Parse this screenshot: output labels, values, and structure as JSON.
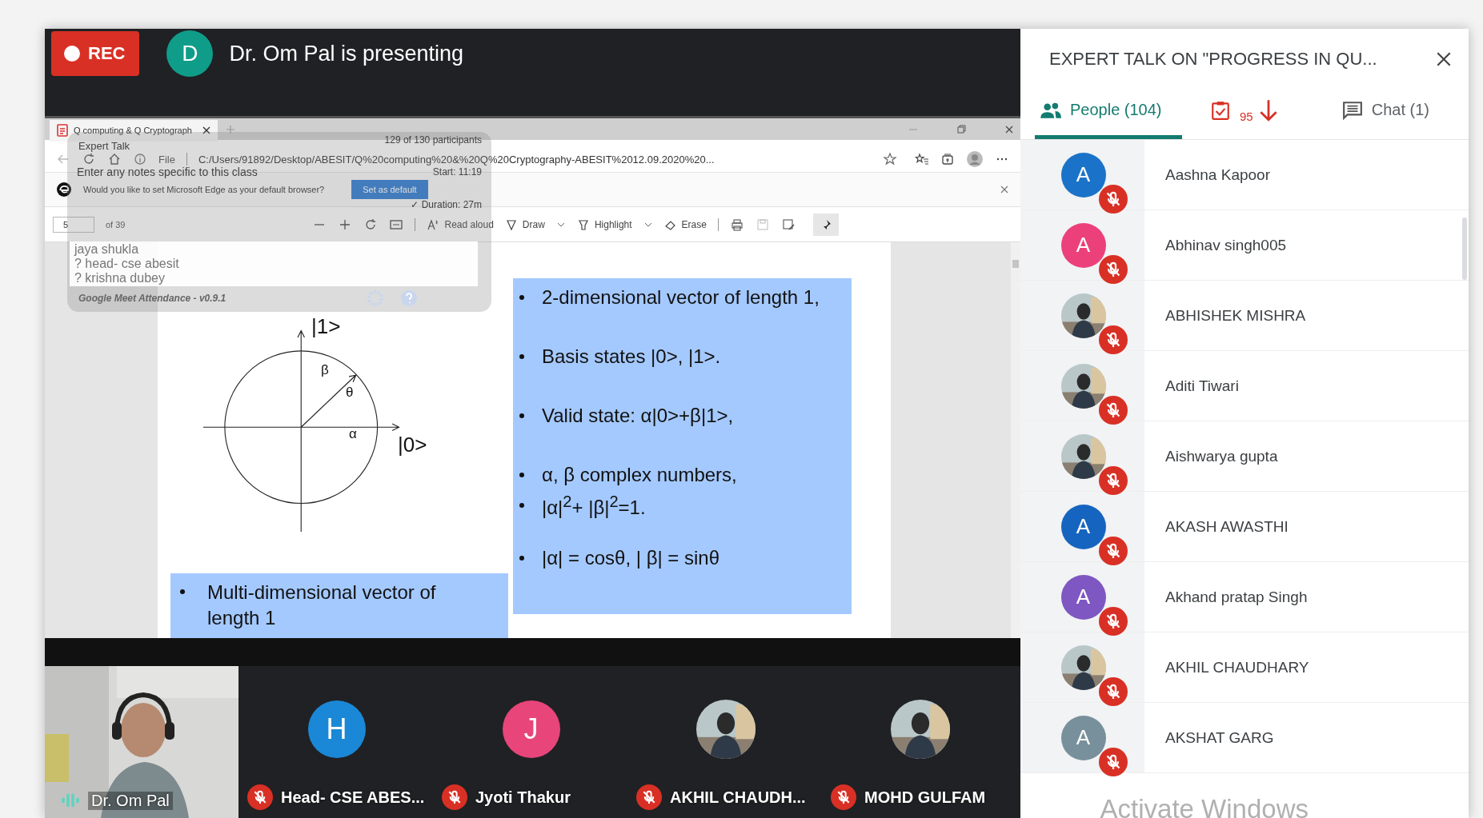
{
  "meeting": {
    "recording_label": "REC",
    "presenter_initial": "D",
    "presenting_text": "Dr. Om Pal is presenting"
  },
  "browser": {
    "tab_title": "Q computing & Q Cryptograph",
    "address_scheme": "File",
    "address": "C:/Users/91892/Desktop/ABESIT/Q%20computing%20&%20Q%20Cryptography-ABESIT%2012.09.2020%20...",
    "infobar": {
      "message": "Would you like to set Microsoft Edge as your default browser?",
      "button": "Set as default"
    },
    "pdf_toolbar": {
      "page": "5",
      "page_count": "of 39",
      "tools": [
        {
          "label": "Read aloud",
          "kind": "read"
        },
        {
          "label": "Draw",
          "kind": "draw"
        },
        {
          "label": "Highlight",
          "kind": "highlight"
        },
        {
          "label": "Erase",
          "kind": "erase"
        }
      ]
    }
  },
  "slide": {
    "axis_y_label": "|1>",
    "axis_x_label": "|0>",
    "beta": "β",
    "theta": "θ",
    "alpha": "α",
    "bullets": [
      {
        "text": "2-dimensional vector of length 1,"
      },
      {
        "text": "Basis states |0>, |1>."
      },
      {
        "text": "Valid state: α|0>+β|1>,"
      },
      {
        "text": " α, β complex numbers,"
      },
      {
        "text": "|α|$^{2}$+ |β|$^{2}$=1."
      },
      {
        "text": "|α| = cosθ, | β| = sinθ"
      }
    ],
    "lower_bullet": "Multi-dimensional vector of length 1"
  },
  "attendance_overlay": {
    "title": "Expert Talk",
    "notes_placeholder": "Enter any notes specific to this class",
    "participants": "129 of 130 participants",
    "start": "Start: 11:19",
    "duration": "✓ Duration: 27m",
    "names": [
      "jaya shukla",
      "? head- cse abesit",
      "? krishna dubey"
    ],
    "footer": "Google Meet Attendance - v0.9.1"
  },
  "tiles": [
    {
      "name": "Dr. Om Pal",
      "kind": "video",
      "speaking": true,
      "muted": false
    },
    {
      "name": "Head- CSE ABES...",
      "kind": "letter",
      "initial": "H",
      "color": "#1a88d6",
      "muted": true
    },
    {
      "name": "Jyoti Thakur",
      "kind": "letter",
      "initial": "J",
      "color": "#e8457a",
      "muted": true
    },
    {
      "name": "AKHIL CHAUDH...",
      "muted": true
    },
    {
      "name": "MOHD GULFAM",
      "muted": true
    }
  ],
  "panel": {
    "title": "EXPERT TALK ON \"PROGRESS IN QU...",
    "tabs": [
      {
        "label": "People (104)",
        "kind": "people",
        "selected": true
      },
      {
        "label": "95",
        "kind": "attendance",
        "selected": false
      },
      {
        "label": "Chat (1)",
        "kind": "chat",
        "selected": false
      }
    ],
    "participants": [
      {
        "name": "Aashna Kapoor",
        "kind": "letter",
        "initial": "A",
        "color": "#1a73c8",
        "muted": true
      },
      {
        "name": "Abhinav singh005",
        "kind": "letter",
        "initial": "A",
        "color": "#ec407a",
        "muted": true
      },
      {
        "name": "ABHISHEK MISHRA",
        "muted": true
      },
      {
        "name": "Aditi Tiwari",
        "muted": true
      },
      {
        "name": "Aishwarya gupta",
        "muted": true
      },
      {
        "name": "AKASH AWASTHI",
        "kind": "letter",
        "initial": "A",
        "color": "#1565c0",
        "muted": true
      },
      {
        "name": "Akhand pratap Singh",
        "kind": "letter",
        "initial": "A",
        "color": "#7e57c2",
        "muted": true
      },
      {
        "name": "AKHIL CHAUDHARY",
        "muted": true
      },
      {
        "name": "AKSHAT GARG",
        "kind": "letter",
        "initial": "A",
        "color": "#78909c",
        "muted": true
      }
    ]
  },
  "os_notice": "Activate Windows"
}
